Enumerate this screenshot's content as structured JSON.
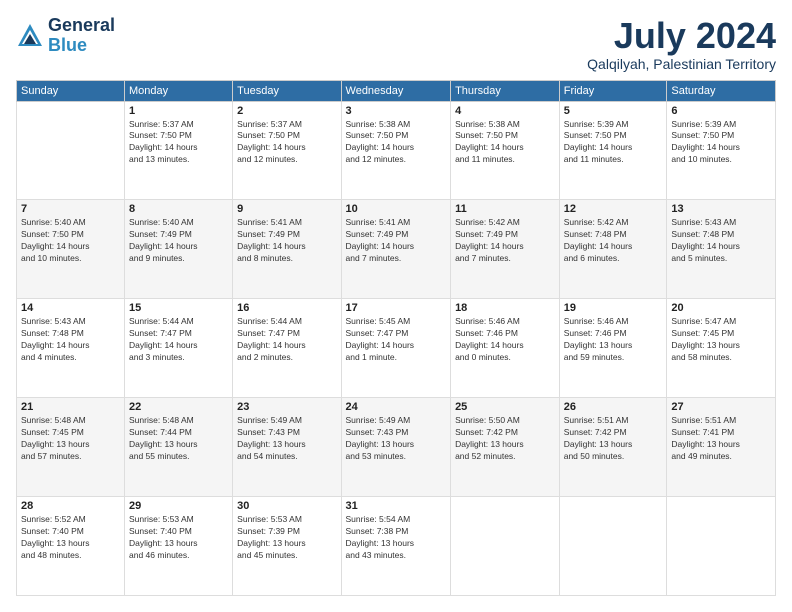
{
  "header": {
    "logo_line1": "General",
    "logo_line2": "Blue",
    "month": "July 2024",
    "location": "Qalqilyah, Palestinian Territory"
  },
  "weekdays": [
    "Sunday",
    "Monday",
    "Tuesday",
    "Wednesday",
    "Thursday",
    "Friday",
    "Saturday"
  ],
  "weeks": [
    [
      {
        "day": "",
        "info": ""
      },
      {
        "day": "1",
        "info": "Sunrise: 5:37 AM\nSunset: 7:50 PM\nDaylight: 14 hours\nand 13 minutes."
      },
      {
        "day": "2",
        "info": "Sunrise: 5:37 AM\nSunset: 7:50 PM\nDaylight: 14 hours\nand 12 minutes."
      },
      {
        "day": "3",
        "info": "Sunrise: 5:38 AM\nSunset: 7:50 PM\nDaylight: 14 hours\nand 12 minutes."
      },
      {
        "day": "4",
        "info": "Sunrise: 5:38 AM\nSunset: 7:50 PM\nDaylight: 14 hours\nand 11 minutes."
      },
      {
        "day": "5",
        "info": "Sunrise: 5:39 AM\nSunset: 7:50 PM\nDaylight: 14 hours\nand 11 minutes."
      },
      {
        "day": "6",
        "info": "Sunrise: 5:39 AM\nSunset: 7:50 PM\nDaylight: 14 hours\nand 10 minutes."
      }
    ],
    [
      {
        "day": "7",
        "info": "Sunrise: 5:40 AM\nSunset: 7:50 PM\nDaylight: 14 hours\nand 10 minutes."
      },
      {
        "day": "8",
        "info": "Sunrise: 5:40 AM\nSunset: 7:49 PM\nDaylight: 14 hours\nand 9 minutes."
      },
      {
        "day": "9",
        "info": "Sunrise: 5:41 AM\nSunset: 7:49 PM\nDaylight: 14 hours\nand 8 minutes."
      },
      {
        "day": "10",
        "info": "Sunrise: 5:41 AM\nSunset: 7:49 PM\nDaylight: 14 hours\nand 7 minutes."
      },
      {
        "day": "11",
        "info": "Sunrise: 5:42 AM\nSunset: 7:49 PM\nDaylight: 14 hours\nand 7 minutes."
      },
      {
        "day": "12",
        "info": "Sunrise: 5:42 AM\nSunset: 7:48 PM\nDaylight: 14 hours\nand 6 minutes."
      },
      {
        "day": "13",
        "info": "Sunrise: 5:43 AM\nSunset: 7:48 PM\nDaylight: 14 hours\nand 5 minutes."
      }
    ],
    [
      {
        "day": "14",
        "info": "Sunrise: 5:43 AM\nSunset: 7:48 PM\nDaylight: 14 hours\nand 4 minutes."
      },
      {
        "day": "15",
        "info": "Sunrise: 5:44 AM\nSunset: 7:47 PM\nDaylight: 14 hours\nand 3 minutes."
      },
      {
        "day": "16",
        "info": "Sunrise: 5:44 AM\nSunset: 7:47 PM\nDaylight: 14 hours\nand 2 minutes."
      },
      {
        "day": "17",
        "info": "Sunrise: 5:45 AM\nSunset: 7:47 PM\nDaylight: 14 hours\nand 1 minute."
      },
      {
        "day": "18",
        "info": "Sunrise: 5:46 AM\nSunset: 7:46 PM\nDaylight: 14 hours\nand 0 minutes."
      },
      {
        "day": "19",
        "info": "Sunrise: 5:46 AM\nSunset: 7:46 PM\nDaylight: 13 hours\nand 59 minutes."
      },
      {
        "day": "20",
        "info": "Sunrise: 5:47 AM\nSunset: 7:45 PM\nDaylight: 13 hours\nand 58 minutes."
      }
    ],
    [
      {
        "day": "21",
        "info": "Sunrise: 5:48 AM\nSunset: 7:45 PM\nDaylight: 13 hours\nand 57 minutes."
      },
      {
        "day": "22",
        "info": "Sunrise: 5:48 AM\nSunset: 7:44 PM\nDaylight: 13 hours\nand 55 minutes."
      },
      {
        "day": "23",
        "info": "Sunrise: 5:49 AM\nSunset: 7:43 PM\nDaylight: 13 hours\nand 54 minutes."
      },
      {
        "day": "24",
        "info": "Sunrise: 5:49 AM\nSunset: 7:43 PM\nDaylight: 13 hours\nand 53 minutes."
      },
      {
        "day": "25",
        "info": "Sunrise: 5:50 AM\nSunset: 7:42 PM\nDaylight: 13 hours\nand 52 minutes."
      },
      {
        "day": "26",
        "info": "Sunrise: 5:51 AM\nSunset: 7:42 PM\nDaylight: 13 hours\nand 50 minutes."
      },
      {
        "day": "27",
        "info": "Sunrise: 5:51 AM\nSunset: 7:41 PM\nDaylight: 13 hours\nand 49 minutes."
      }
    ],
    [
      {
        "day": "28",
        "info": "Sunrise: 5:52 AM\nSunset: 7:40 PM\nDaylight: 13 hours\nand 48 minutes."
      },
      {
        "day": "29",
        "info": "Sunrise: 5:53 AM\nSunset: 7:40 PM\nDaylight: 13 hours\nand 46 minutes."
      },
      {
        "day": "30",
        "info": "Sunrise: 5:53 AM\nSunset: 7:39 PM\nDaylight: 13 hours\nand 45 minutes."
      },
      {
        "day": "31",
        "info": "Sunrise: 5:54 AM\nSunset: 7:38 PM\nDaylight: 13 hours\nand 43 minutes."
      },
      {
        "day": "",
        "info": ""
      },
      {
        "day": "",
        "info": ""
      },
      {
        "day": "",
        "info": ""
      }
    ]
  ]
}
